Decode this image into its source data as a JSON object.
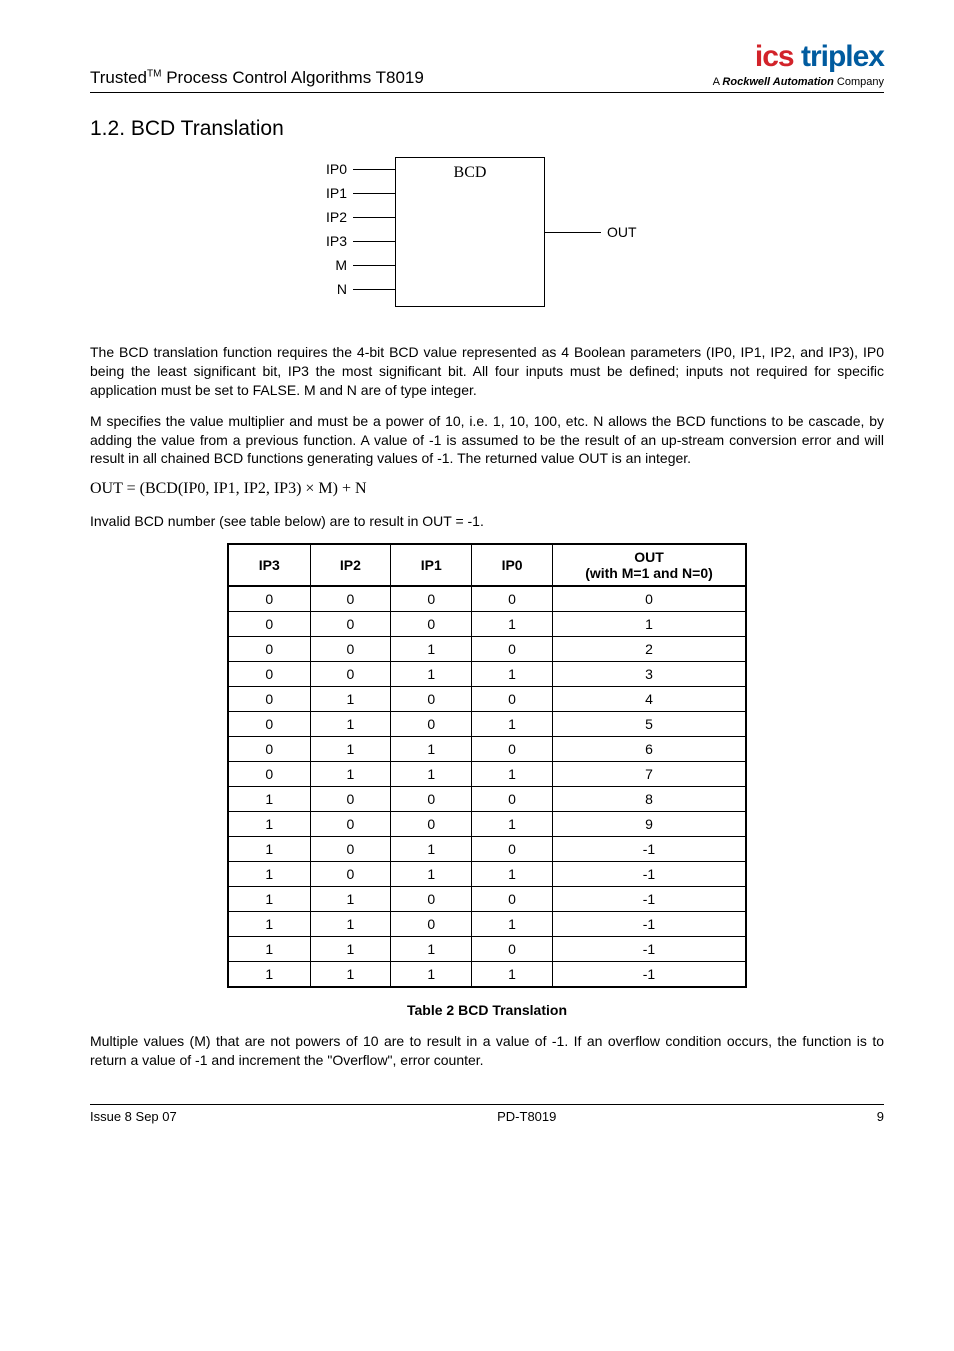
{
  "header": {
    "doc_title_prefix": "Trusted",
    "doc_title_suffix": " Process Control Algorithms T8019",
    "tm": "TM",
    "logo_ics": "ics",
    "logo_triplex": " triplex",
    "logo_sub_prefix": "A ",
    "logo_sub_rock": "Rockwell Automation",
    "logo_sub_suffix": " Company"
  },
  "section": {
    "number": "1.2.",
    "title": "BCD Translation"
  },
  "diagram": {
    "inputs": [
      "IP0",
      "IP1",
      "IP2",
      "IP3",
      "M",
      "N"
    ],
    "box_label": "BCD",
    "output": "OUT"
  },
  "para1": "The BCD translation function requires the 4-bit BCD value represented as 4 Boolean parameters (IP0, IP1, IP2, and IP3), IP0 being the least significant bit, IP3 the most significant bit.  All four inputs must be defined; inputs not required for specific application must be set to FALSE. M and N are of type integer.",
  "para2": "M specifies the value multiplier and must be a power of 10, i.e. 1, 10, 100, etc.  N allows the BCD functions to be cascade, by adding the value from a previous function.  A value of -1 is assumed to be the result of an up-stream conversion error and will result in all chained BCD functions generating values of -1.  The returned value OUT is an integer.",
  "formula": "OUT = (BCD(IP0, IP1, IP2, IP3) × M) + N",
  "para3": "Invalid BCD number (see table below) are to result in OUT = -1.",
  "table": {
    "headers": {
      "ip3": "IP3",
      "ip2": "IP2",
      "ip1": "IP1",
      "ip0": "IP0",
      "out_line1": "OUT",
      "out_line2": "(with M=1 and N=0)"
    }
  },
  "chart_data": {
    "type": "table",
    "columns": [
      "IP3",
      "IP2",
      "IP1",
      "IP0",
      "OUT (with M=1 and N=0)"
    ],
    "rows": [
      [
        0,
        0,
        0,
        0,
        0
      ],
      [
        0,
        0,
        0,
        1,
        1
      ],
      [
        0,
        0,
        1,
        0,
        2
      ],
      [
        0,
        0,
        1,
        1,
        3
      ],
      [
        0,
        1,
        0,
        0,
        4
      ],
      [
        0,
        1,
        0,
        1,
        5
      ],
      [
        0,
        1,
        1,
        0,
        6
      ],
      [
        0,
        1,
        1,
        1,
        7
      ],
      [
        1,
        0,
        0,
        0,
        8
      ],
      [
        1,
        0,
        0,
        1,
        9
      ],
      [
        1,
        0,
        1,
        0,
        -1
      ],
      [
        1,
        0,
        1,
        1,
        -1
      ],
      [
        1,
        1,
        0,
        0,
        -1
      ],
      [
        1,
        1,
        0,
        1,
        -1
      ],
      [
        1,
        1,
        1,
        0,
        -1
      ],
      [
        1,
        1,
        1,
        1,
        -1
      ]
    ]
  },
  "table_caption": "Table 2 BCD Translation",
  "para4": "Multiple values (M) that are not powers of 10 are to result in a value of -1.  If an overflow condition occurs, the function is to return a value of -1 and increment the \"Overflow\", error counter.",
  "footer": {
    "left": "Issue 8 Sep 07",
    "center": "PD-T8019",
    "right": "9"
  }
}
